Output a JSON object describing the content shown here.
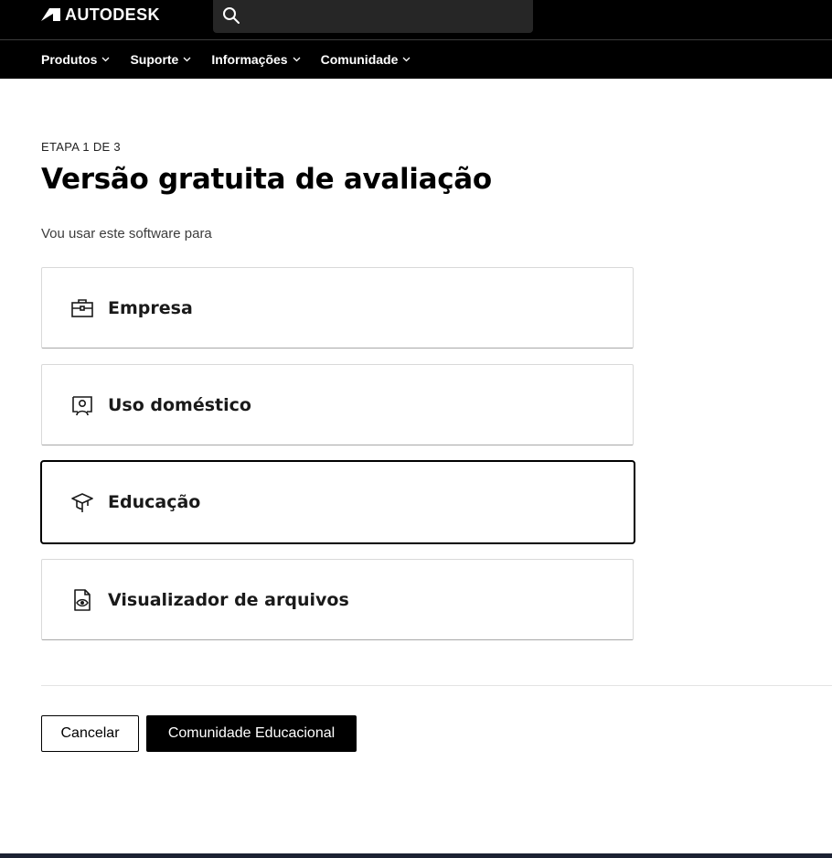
{
  "header": {
    "brand": "AUTODESK",
    "search": {
      "value": "",
      "placeholder": ""
    }
  },
  "nav": {
    "items": [
      {
        "label": "Produtos"
      },
      {
        "label": "Suporte"
      },
      {
        "label": "Informações"
      },
      {
        "label": "Comunidade"
      }
    ]
  },
  "main": {
    "step": "ETAPA 1 DE 3",
    "title": "Versão gratuita de avaliação",
    "subtitle": "Vou usar este software para",
    "options": [
      {
        "label": "Empresa",
        "icon": "briefcase-icon",
        "selected": false
      },
      {
        "label": "Uso doméstico",
        "icon": "home-user-icon",
        "selected": false
      },
      {
        "label": "Educação",
        "icon": "graduation-cap-icon",
        "selected": true
      },
      {
        "label": "Visualizador de arquivos",
        "icon": "file-viewer-icon",
        "selected": false
      }
    ]
  },
  "actions": {
    "cancel_label": "Cancelar",
    "primary_label": "Comunidade Educacional"
  },
  "colors": {
    "header_bg": "#000000",
    "search_bg": "#262626",
    "primary_button_bg": "#000000",
    "selected_border": "#000000",
    "option_border": "#d9d9d9"
  }
}
